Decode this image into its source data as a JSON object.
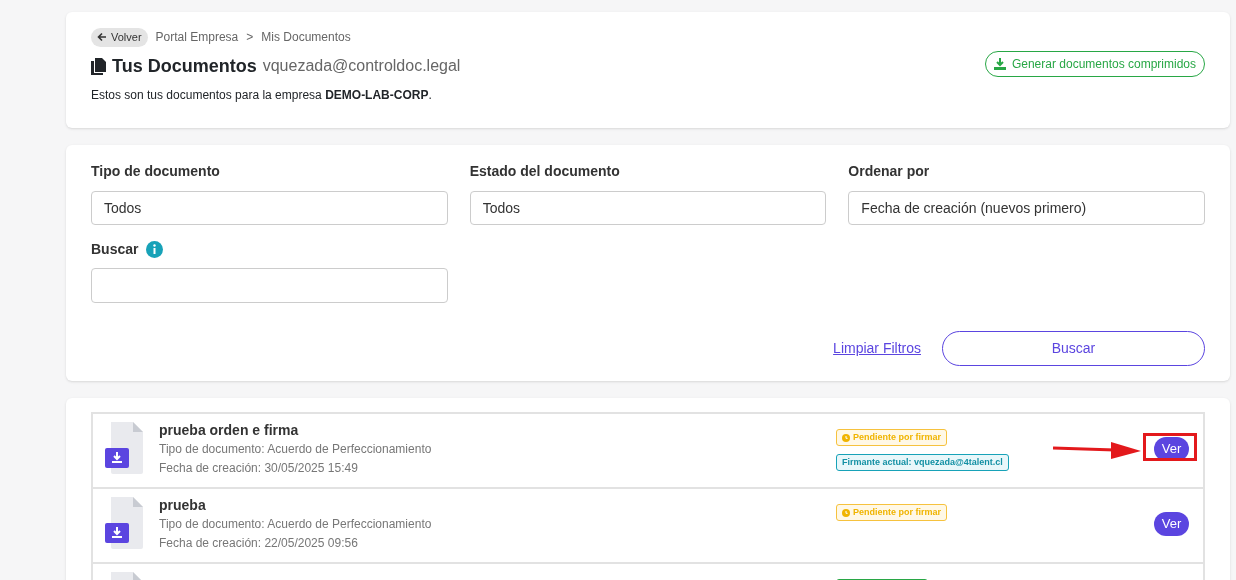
{
  "header": {
    "back_button": "Volver",
    "breadcrumb": [
      "Portal Empresa",
      "Mis Documentos"
    ],
    "breadcrumb_separator": ">",
    "title": "Tus Documentos",
    "email": "vquezada@controldoc.legal",
    "description": "Estos son tus documentos para la empresa **DEMO-LAB-CORP**.",
    "generate_button": "Generar documentos comprimidos"
  },
  "filters": {
    "fields": [
      {
        "label": "Tipo de documento",
        "value": "Todos"
      },
      {
        "label": "Estado del documento",
        "value": "Todos"
      },
      {
        "label": "Ordenar por",
        "value": "Fecha de creación (nuevos primero)"
      }
    ],
    "search": {
      "label": "Buscar"
    },
    "clear_link": "Limpiar Filtros",
    "search_button": "Buscar"
  },
  "documents": [
    {
      "title": "prueba orden e firma",
      "type": "Tipo de documento: Acuerdo de Perfeccionamiento",
      "date": "Fecha de creación: 30/05/2025 15:49",
      "badges": [
        {
          "kind": "pending",
          "label": "Pendiente por firmar"
        },
        {
          "kind": "signer",
          "label": "Firmante actual: vquezada@4talent.cl"
        }
      ],
      "button": "Ver",
      "highlighted": true
    },
    {
      "title": "prueba",
      "type": "Tipo de documento: Acuerdo de Perfeccionamiento",
      "date": "Fecha de creación: 22/05/2025 09:56",
      "badges": [
        {
          "kind": "pending",
          "label": "Pendiente por firmar"
        }
      ],
      "button": "Ver",
      "highlighted": false
    },
    {
      "badges": [
        {
          "kind": "signed"
        }
      ]
    }
  ]
}
